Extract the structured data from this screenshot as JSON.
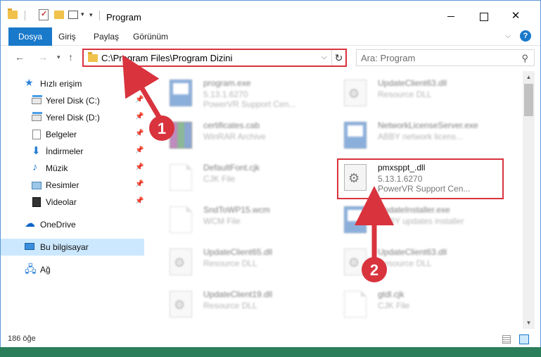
{
  "window": {
    "title": "Program"
  },
  "ribbon": {
    "tabs": [
      "Dosya",
      "Giriş",
      "Paylaş",
      "Görünüm"
    ]
  },
  "address": {
    "path": "C:\\Program Files\\Program Dizini"
  },
  "search": {
    "placeholder": "Ara: Program"
  },
  "sidebar": {
    "items": [
      {
        "label": "Hızlı erişim",
        "icon": "star-icon"
      },
      {
        "label": "Yerel Disk (C:)",
        "icon": "disk-icon"
      },
      {
        "label": "Yerel Disk (D:)",
        "icon": "disk-icon"
      },
      {
        "label": "Belgeler",
        "icon": "documents-icon"
      },
      {
        "label": "İndirmeler",
        "icon": "download-icon"
      },
      {
        "label": "Müzik",
        "icon": "music-icon"
      },
      {
        "label": "Resimler",
        "icon": "pictures-icon"
      },
      {
        "label": "Videolar",
        "icon": "videos-icon"
      },
      {
        "label": "OneDrive",
        "icon": "cloud-icon"
      },
      {
        "label": "Bu bilgisayar",
        "icon": "computer-icon"
      },
      {
        "label": "Ağ",
        "icon": "network-icon"
      }
    ]
  },
  "files": [
    {
      "name": "program.exe",
      "line2": "5.13.1.6270",
      "line3": "PowerVR Support Cen...",
      "icon": "exe-icon"
    },
    {
      "name": "UpdateClient63.dll",
      "line2": "Resource DLL",
      "line3": "",
      "icon": "dll-icon"
    },
    {
      "name": "certificates.cab",
      "line2": "WinRAR Archive",
      "line3": "",
      "icon": "archive-icon"
    },
    {
      "name": "NetworkLicenseServer.exe",
      "line2": "ABBY network licens...",
      "line3": "",
      "icon": "exe-icon"
    },
    {
      "name": "DefaultFont.cjk",
      "line2": "CJK File",
      "line3": "",
      "icon": "file-icon"
    },
    {
      "name": "pmxsppt_.dll",
      "line2": "5.13.1.6270",
      "line3": "PowerVR Support Cen...",
      "icon": "dll-icon"
    },
    {
      "name": "SndToWP15.wcm",
      "line2": "WCM File",
      "line3": "",
      "icon": "file-icon"
    },
    {
      "name": "UpdateInstaller.exe",
      "line2": "ABBY updates installer",
      "line3": "",
      "icon": "exe-icon"
    },
    {
      "name": "UpdateClient65.dll",
      "line2": "Resource DLL",
      "line3": "",
      "icon": "dll-icon"
    },
    {
      "name": "UpdateClient63.dll",
      "line2": "Resource DLL",
      "line3": "",
      "icon": "dll-icon"
    },
    {
      "name": "UpdateClient19.dll",
      "line2": "Resource DLL",
      "line3": "",
      "icon": "dll-icon"
    },
    {
      "name": "gtdl.cjk",
      "line2": "CJK File",
      "line3": "",
      "icon": "file-icon"
    }
  ],
  "status": {
    "count": "186 öğe"
  },
  "annotations": {
    "step1": "1",
    "step2": "2",
    "color": "#d9333d"
  }
}
